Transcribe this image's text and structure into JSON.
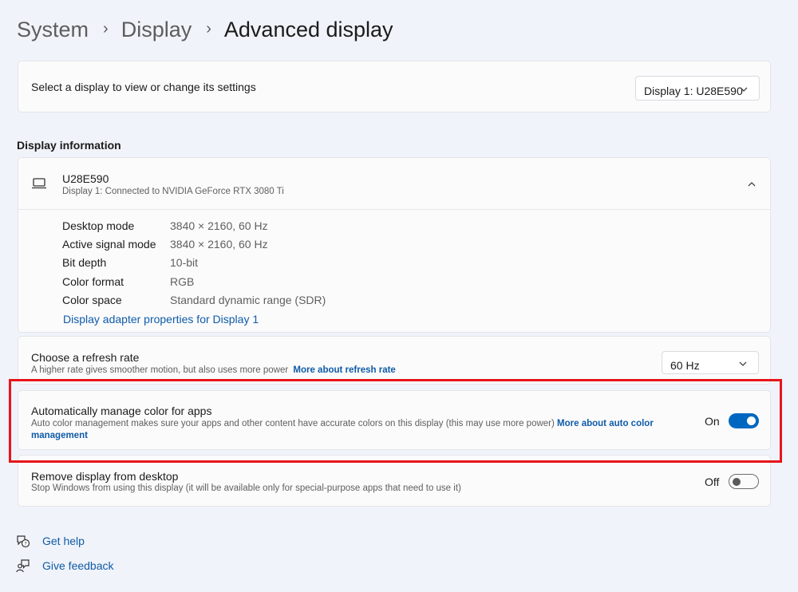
{
  "breadcrumb": {
    "items": [
      "System",
      "Display",
      "Advanced display"
    ]
  },
  "select_display": {
    "label": "Select a display to view or change its settings",
    "dropdown_value": "Display 1: U28E590"
  },
  "display_information": {
    "section_title": "Display information",
    "monitor_name": "U28E590",
    "monitor_connection": "Display 1: Connected to NVIDIA GeForce RTX 3080 Ti",
    "rows": [
      {
        "label": "Desktop mode",
        "value": "3840 × 2160, 60 Hz"
      },
      {
        "label": "Active signal mode",
        "value": "3840 × 2160, 60 Hz"
      },
      {
        "label": "Bit depth",
        "value": "10-bit"
      },
      {
        "label": "Color format",
        "value": "RGB"
      },
      {
        "label": "Color space",
        "value": "Standard dynamic range (SDR)"
      }
    ],
    "adapter_link": "Display adapter properties for Display 1"
  },
  "refresh_rate": {
    "title": "Choose a refresh rate",
    "description": "A higher rate gives smoother motion, but also uses more power",
    "link": "More about refresh rate",
    "value": "60 Hz"
  },
  "auto_color": {
    "title": "Automatically manage color for apps",
    "description": "Auto color management makes sure your apps and other content have accurate colors on this display (this may use more power)",
    "link": "More about auto color management",
    "state_label": "On",
    "enabled": true
  },
  "remove_display": {
    "title": "Remove display from desktop",
    "description": "Stop Windows from using this display (it will be available only for special-purpose apps that need to use it)",
    "state_label": "Off",
    "enabled": false
  },
  "footer": {
    "get_help": "Get help",
    "give_feedback": "Give feedback"
  },
  "colors": {
    "accent": "#0067c0",
    "link": "#0f5ba7",
    "highlight": "#e8141b",
    "background": "#f0f3f9",
    "card": "#fbfbfc"
  },
  "icons": {
    "monitor": "laptop-icon",
    "help": "help-icon",
    "feedback": "feedback-icon"
  }
}
